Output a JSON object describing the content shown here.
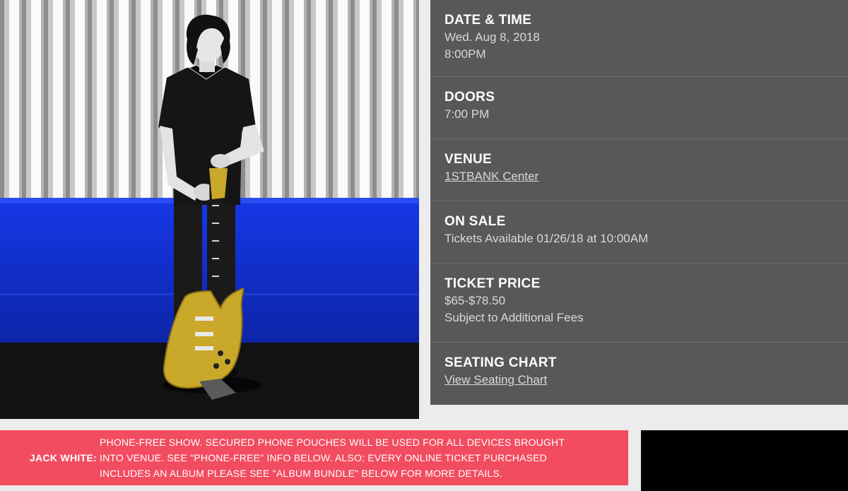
{
  "event": {
    "image_alt": "Jack White promotional photo",
    "sections": [
      {
        "heading": "DATE & TIME",
        "lines": [
          "Wed. Aug 8, 2018",
          "8:00PM"
        ]
      },
      {
        "heading": "DOORS",
        "lines": [
          "7:00 PM"
        ]
      },
      {
        "heading": "VENUE",
        "link": "1STBANK Center"
      },
      {
        "heading": "ON SALE",
        "lines": [
          "Tickets Available 01/26/18 at 10:00AM"
        ]
      },
      {
        "heading": "TICKET PRICE",
        "lines": [
          "$65-$78.50",
          "Subject to Additional Fees"
        ]
      },
      {
        "heading": "SEATING CHART",
        "link": "View Seating Chart"
      }
    ]
  },
  "alert": {
    "artist": "JACK WHITE:",
    "message": "PHONE-FREE SHOW. SECURED PHONE POUCHES WILL BE USED FOR ALL DEVICES BROUGHT INTO VENUE. SEE \"PHONE-FREE\" INFO BELOW. ALSO: EVERY ONLINE TICKET PURCHASED INCLUDES AN ALBUM PLEASE SEE \"ALBUM BUNDLE\" BELOW FOR MORE DETAILS."
  },
  "colors": {
    "panel_bg": "#585858",
    "alert_bg": "#f24c60",
    "wall_blue": "#1433d9",
    "guitar_gold": "#c9a82a"
  }
}
